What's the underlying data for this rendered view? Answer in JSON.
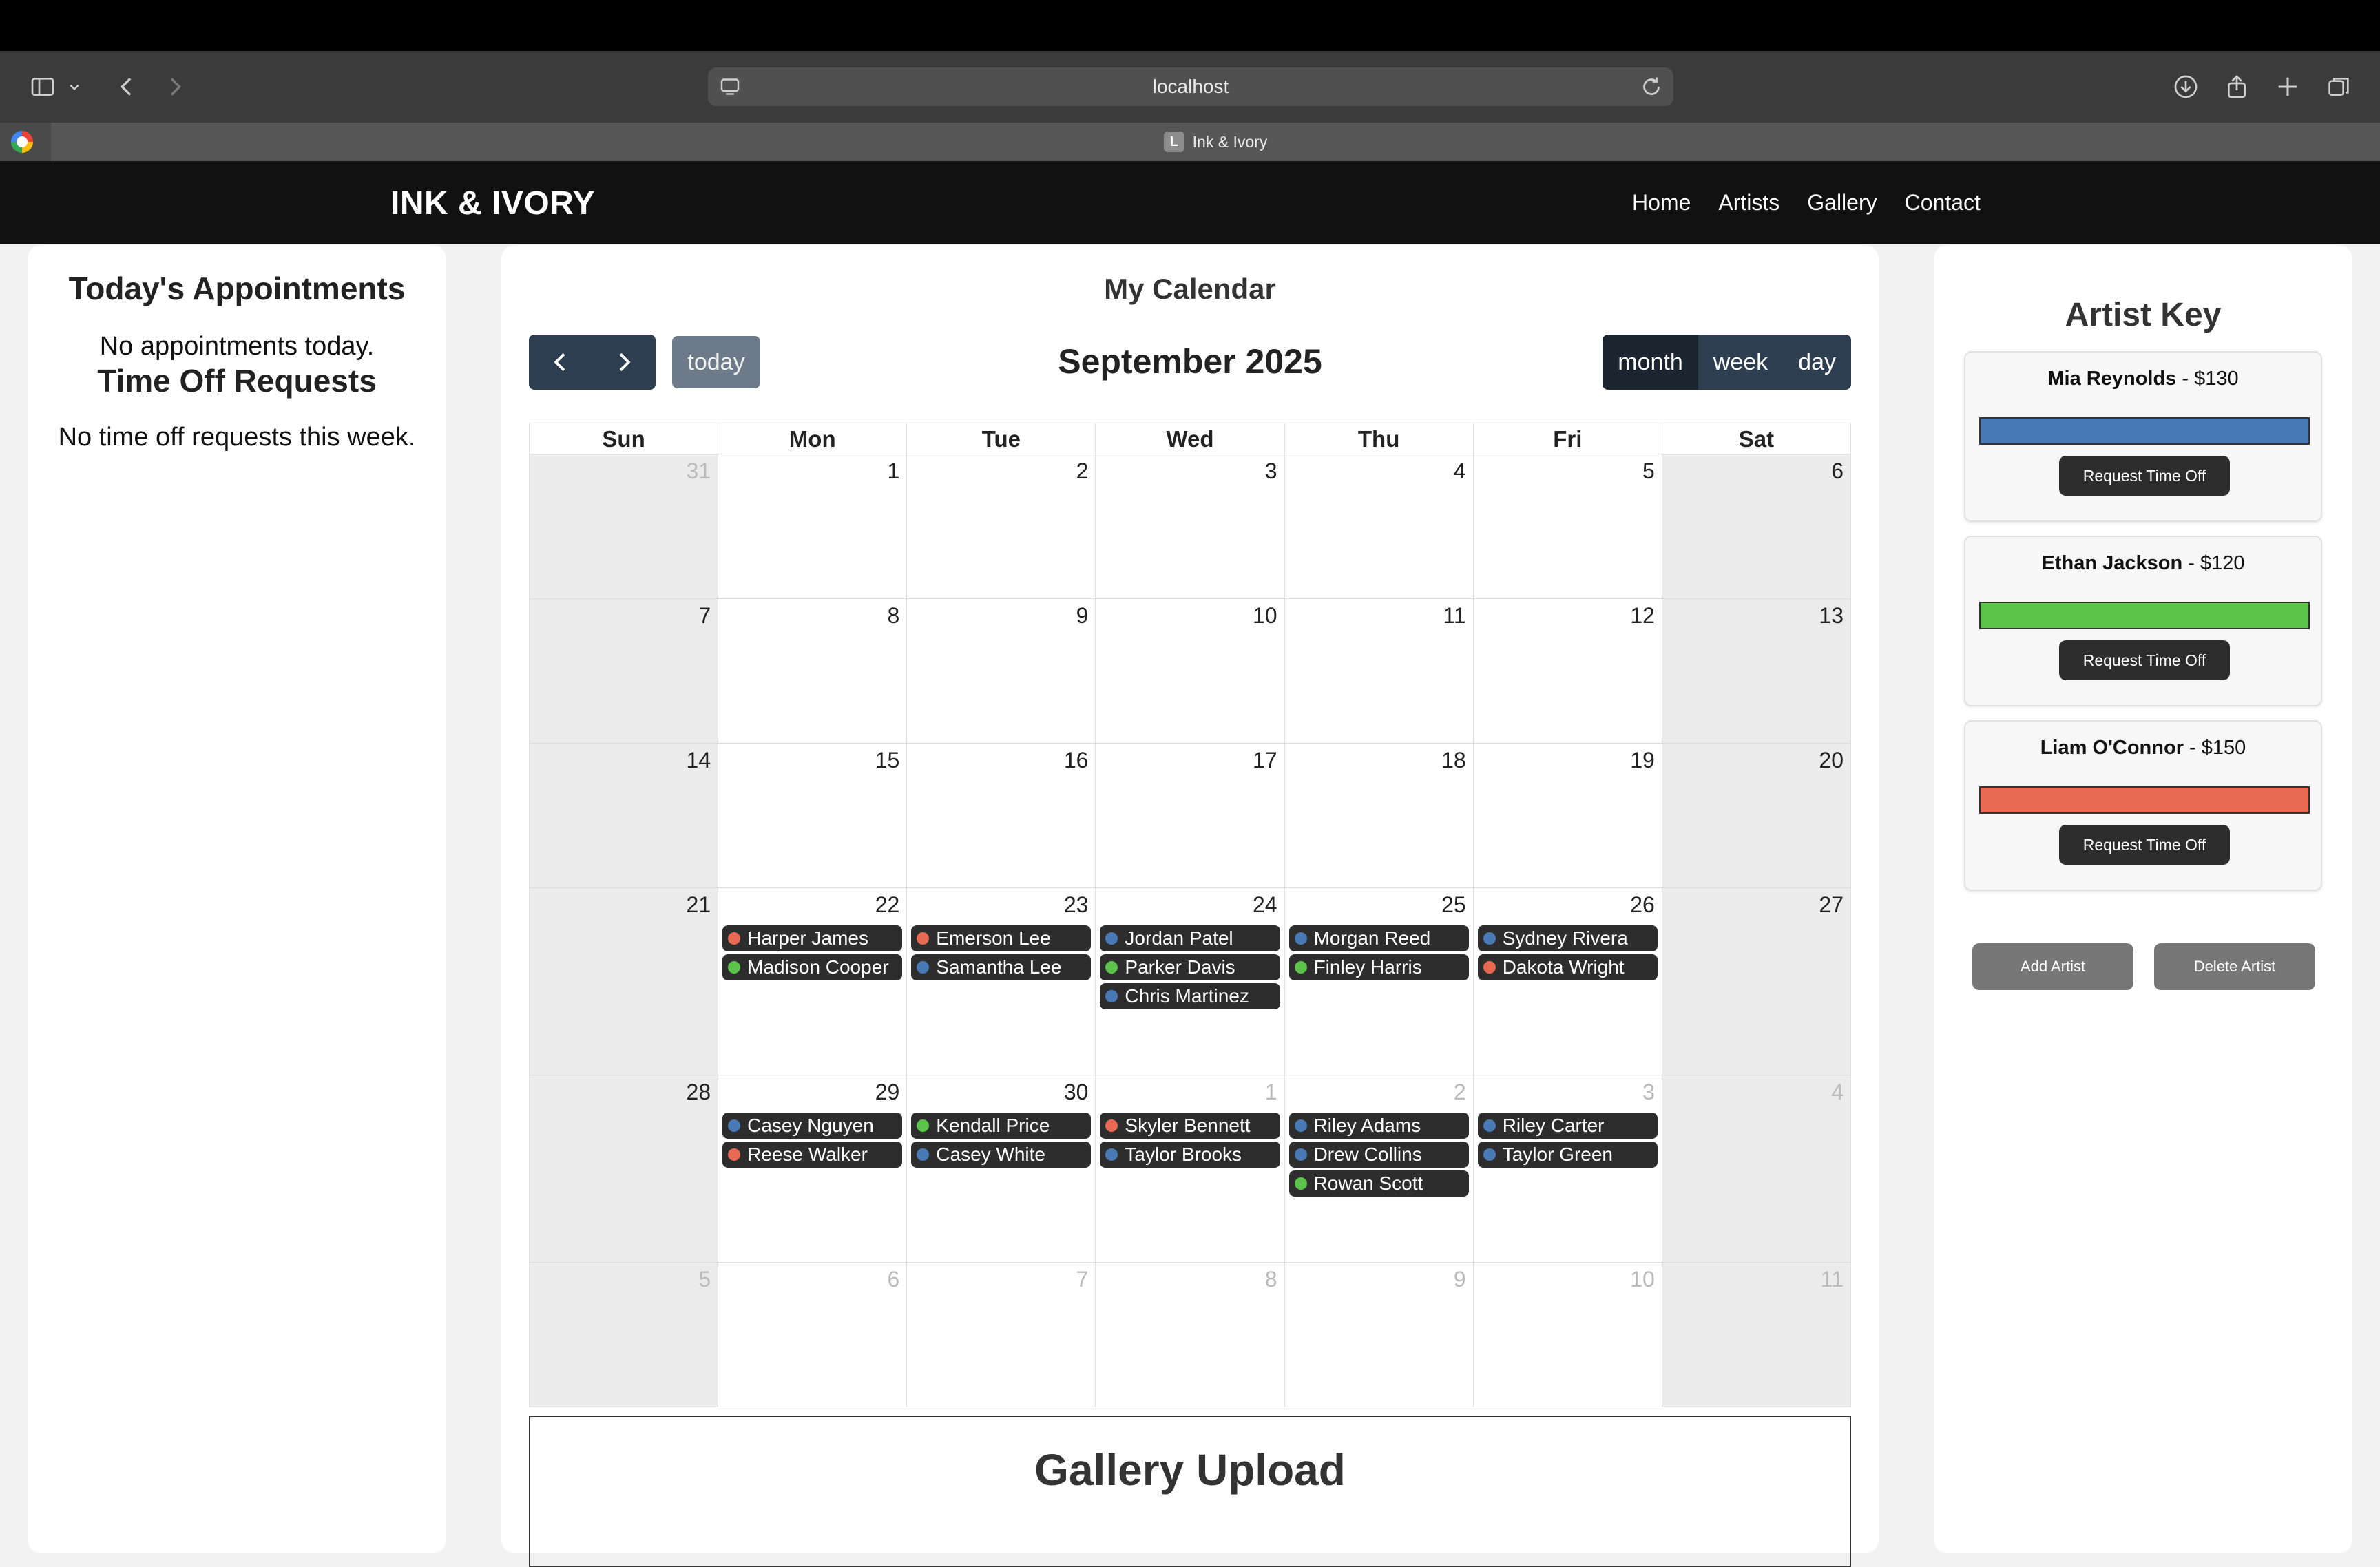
{
  "browser": {
    "url": "localhost",
    "tab_title": "Ink & Ivory",
    "tab_favicon_letter": "L"
  },
  "site": {
    "logo": "INK & IVORY",
    "nav": [
      "Home",
      "Artists",
      "Gallery",
      "Contact"
    ]
  },
  "left_panel": {
    "appointments_heading": "Today's Appointments",
    "appointments_empty": "No appointments today.",
    "timeoff_heading": "Time Off Requests",
    "timeoff_empty": "No time off requests this week."
  },
  "calendar": {
    "heading": "My Calendar",
    "month_title": "September 2025",
    "today_label": "today",
    "views": [
      "month",
      "week",
      "day"
    ],
    "active_view": "month",
    "days_of_week": [
      "Sun",
      "Mon",
      "Tue",
      "Wed",
      "Thu",
      "Fri",
      "Sat"
    ],
    "weeks": [
      [
        {
          "d": "31",
          "o": true
        },
        {
          "d": "1"
        },
        {
          "d": "2"
        },
        {
          "d": "3"
        },
        {
          "d": "4"
        },
        {
          "d": "5"
        },
        {
          "d": "6"
        }
      ],
      [
        {
          "d": "7"
        },
        {
          "d": "8"
        },
        {
          "d": "9"
        },
        {
          "d": "10"
        },
        {
          "d": "11"
        },
        {
          "d": "12"
        },
        {
          "d": "13"
        }
      ],
      [
        {
          "d": "14"
        },
        {
          "d": "15"
        },
        {
          "d": "16"
        },
        {
          "d": "17"
        },
        {
          "d": "18"
        },
        {
          "d": "19"
        },
        {
          "d": "20"
        }
      ],
      [
        {
          "d": "21"
        },
        {
          "d": "22",
          "events": [
            {
              "name": "Harper James",
              "artist": "Liam O'Connor"
            },
            {
              "name": "Madison Cooper",
              "artist": "Ethan Jackson"
            }
          ]
        },
        {
          "d": "23",
          "events": [
            {
              "name": "Emerson Lee",
              "artist": "Liam O'Connor"
            },
            {
              "name": "Samantha Lee",
              "artist": "Mia Reynolds"
            }
          ]
        },
        {
          "d": "24",
          "events": [
            {
              "name": "Jordan Patel",
              "artist": "Mia Reynolds"
            },
            {
              "name": "Parker Davis",
              "artist": "Ethan Jackson"
            },
            {
              "name": "Chris Martinez",
              "artist": "Mia Reynolds"
            }
          ]
        },
        {
          "d": "25",
          "events": [
            {
              "name": "Morgan Reed",
              "artist": "Mia Reynolds"
            },
            {
              "name": "Finley Harris",
              "artist": "Ethan Jackson"
            }
          ]
        },
        {
          "d": "26",
          "events": [
            {
              "name": "Sydney Rivera",
              "artist": "Mia Reynolds"
            },
            {
              "name": "Dakota Wright",
              "artist": "Liam O'Connor"
            }
          ]
        },
        {
          "d": "27"
        }
      ],
      [
        {
          "d": "28"
        },
        {
          "d": "29",
          "events": [
            {
              "name": "Casey Nguyen",
              "artist": "Mia Reynolds"
            },
            {
              "name": "Reese Walker",
              "artist": "Liam O'Connor"
            }
          ]
        },
        {
          "d": "30",
          "events": [
            {
              "name": "Kendall Price",
              "artist": "Ethan Jackson"
            },
            {
              "name": "Casey White",
              "artist": "Mia Reynolds"
            }
          ]
        },
        {
          "d": "1",
          "o": true,
          "events": [
            {
              "name": "Skyler Bennett",
              "artist": "Liam O'Connor"
            },
            {
              "name": "Taylor Brooks",
              "artist": "Mia Reynolds"
            }
          ]
        },
        {
          "d": "2",
          "o": true,
          "events": [
            {
              "name": "Riley Adams",
              "artist": "Mia Reynolds"
            },
            {
              "name": "Drew Collins",
              "artist": "Mia Reynolds"
            },
            {
              "name": "Rowan Scott",
              "artist": "Ethan Jackson"
            }
          ]
        },
        {
          "d": "3",
          "o": true,
          "events": [
            {
              "name": "Riley Carter",
              "artist": "Mia Reynolds"
            },
            {
              "name": "Taylor Green",
              "artist": "Mia Reynolds"
            }
          ]
        },
        {
          "d": "4",
          "o": true
        }
      ],
      [
        {
          "d": "5",
          "o": true
        },
        {
          "d": "6",
          "o": true
        },
        {
          "d": "7",
          "o": true
        },
        {
          "d": "8",
          "o": true
        },
        {
          "d": "9",
          "o": true
        },
        {
          "d": "10",
          "o": true
        },
        {
          "d": "11",
          "o": true
        }
      ]
    ]
  },
  "gallery": {
    "heading": "Gallery Upload"
  },
  "artist_key": {
    "heading": "Artist Key",
    "artists": [
      {
        "name": "Mia Reynolds",
        "price": " - $130",
        "color": "#4a7ab5"
      },
      {
        "name": "Ethan Jackson",
        "price": " - $120",
        "color": "#5cc44a"
      },
      {
        "name": "Liam O'Connor",
        "price": " - $150",
        "color": "#e86a52"
      }
    ],
    "request_label": "Request Time Off",
    "add_label": "Add Artist",
    "delete_label": "Delete Artist"
  }
}
